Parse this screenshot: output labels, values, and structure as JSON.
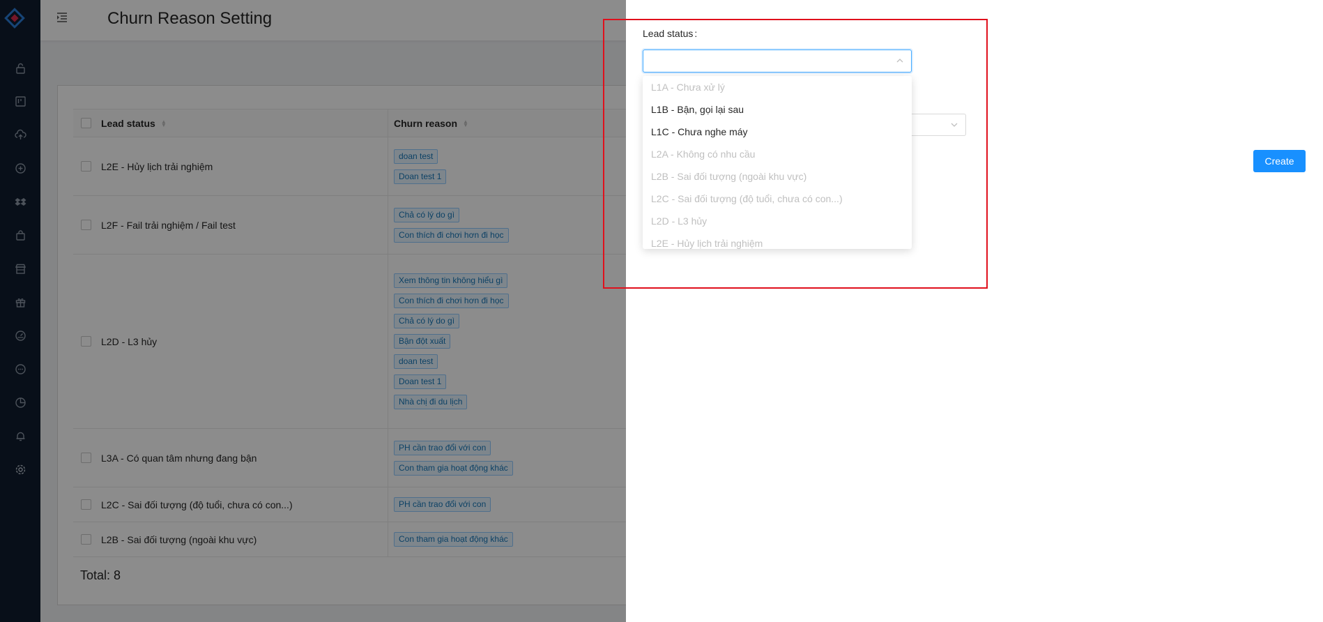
{
  "page": {
    "title": "Churn Reason Setting",
    "total_label": "Total: 8"
  },
  "colors": {
    "sidebar_bg": "#0f1d2e",
    "primary": "#1890ff",
    "highlight": "#e0101c",
    "tag_text": "#1677b8"
  },
  "sidebar": {
    "items": [
      {
        "icon": "lock-icon"
      },
      {
        "icon": "kanban-icon"
      },
      {
        "icon": "cloud-upload-icon"
      },
      {
        "icon": "plus-circle-icon"
      },
      {
        "icon": "dropbox-icon"
      },
      {
        "icon": "shopping-bag-icon"
      },
      {
        "icon": "shop-icon"
      },
      {
        "icon": "gift-icon"
      },
      {
        "icon": "dashboard-icon"
      },
      {
        "icon": "message-icon"
      },
      {
        "icon": "pie-chart-icon"
      },
      {
        "icon": "bell-icon"
      },
      {
        "icon": "settings-icon"
      }
    ]
  },
  "table": {
    "columns": [
      "Lead status",
      "Churn reason"
    ],
    "rows": [
      {
        "status": "L2E - Hủy lịch trải nghiệm",
        "reasons": [
          "doan test",
          "Doan test 1"
        ]
      },
      {
        "status": "L2F - Fail trải nghiệm / Fail test",
        "reasons": [
          "Chả có lý do gì",
          "Con thích đi chơi hơn đi học"
        ]
      },
      {
        "status": "L2D - L3 hủy",
        "reasons": [
          "Xem thông tin không hiểu gì",
          "Con thích đi chơi hơn đi học",
          "Chả có lý do gì",
          "Bận đột xuất",
          "doan test",
          "Doan test 1",
          "Nhà chị đi du lịch"
        ]
      },
      {
        "status": "L3A - Có quan tâm nhưng đang bận",
        "reasons": [
          "PH cần trao đổi với con",
          "Con tham gia hoạt động khác"
        ]
      },
      {
        "status": "L2C - Sai đối tượng (độ tuổi, chưa có con...)",
        "reasons": [
          "PH cần trao đổi với con"
        ]
      },
      {
        "status": "L2B - Sai đối tượng (ngoài khu vực)",
        "reasons": [
          "Con tham gia hoạt động khác"
        ]
      }
    ]
  },
  "drawer": {
    "lead_status_label": "Lead status",
    "lead_status_value": "",
    "create_label": "Create",
    "options": [
      {
        "label": "L1A - Chưa xử lý",
        "disabled": true
      },
      {
        "label": "L1B - Bận, gọi lại sau",
        "disabled": false
      },
      {
        "label": "L1C - Chưa nghe máy",
        "disabled": false
      },
      {
        "label": "L2A - Không có nhu cầu",
        "disabled": true
      },
      {
        "label": "L2B - Sai đối tượng (ngoài khu vực)",
        "disabled": true
      },
      {
        "label": "L2C - Sai đối tượng (độ tuổi, chưa có con...)",
        "disabled": true
      },
      {
        "label": "L2D - L3 hủy",
        "disabled": true
      },
      {
        "label": "L2E - Hủy lịch trải nghiệm",
        "disabled": true
      }
    ]
  }
}
